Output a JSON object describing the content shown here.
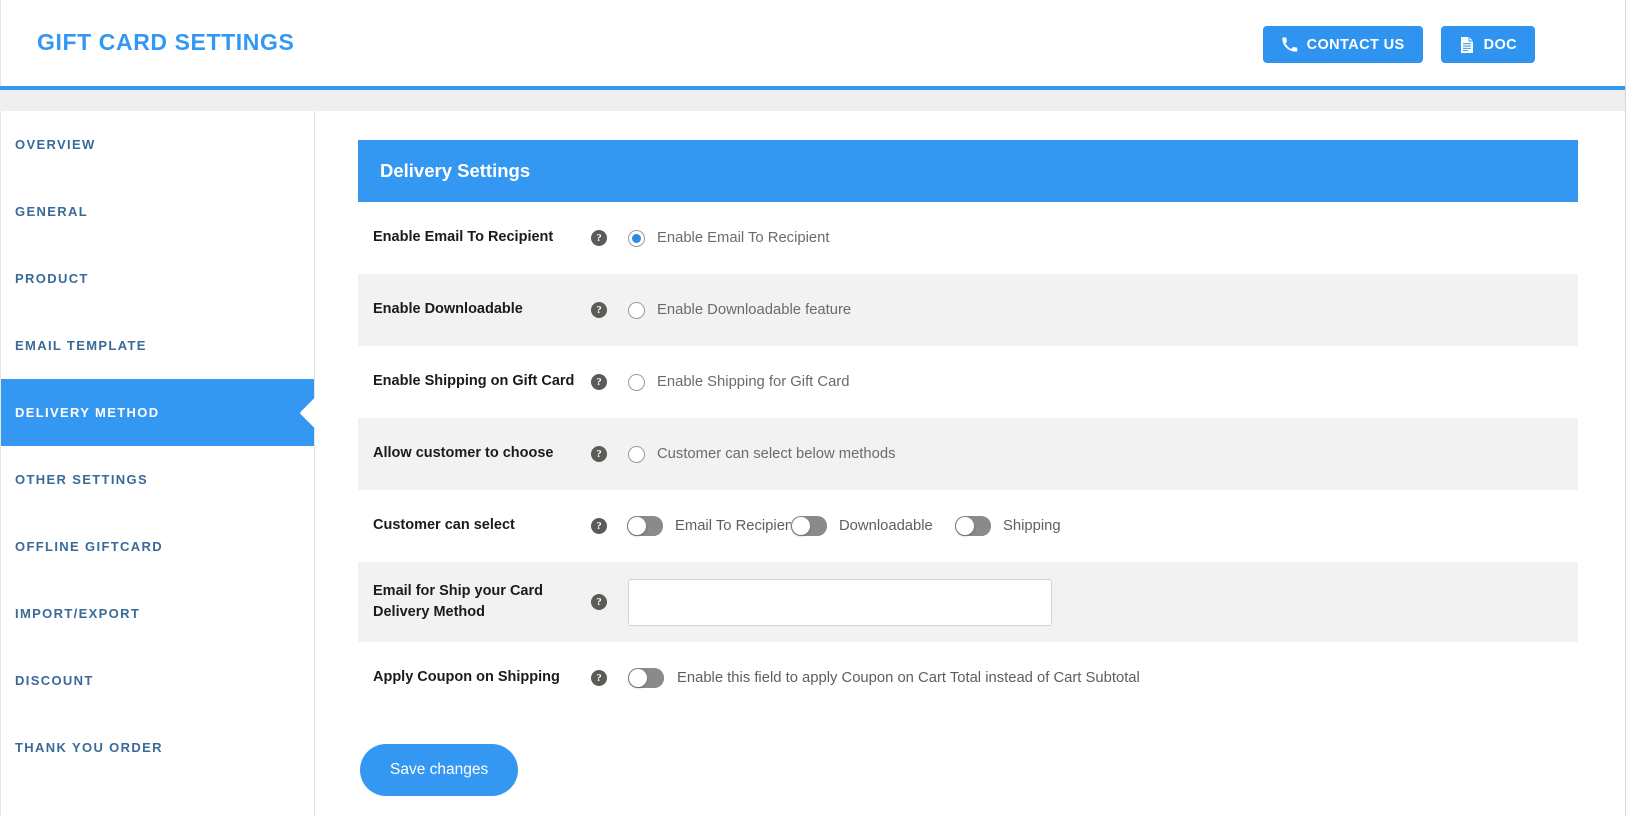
{
  "header": {
    "title": "GIFT CARD SETTINGS",
    "contact_label": "CONTACT US",
    "doc_label": "DOC",
    "accent_color": "#3498f3"
  },
  "sidebar": {
    "items": [
      {
        "label": "OVERVIEW",
        "active": false
      },
      {
        "label": "GENERAL",
        "active": false
      },
      {
        "label": "PRODUCT",
        "active": false
      },
      {
        "label": "EMAIL TEMPLATE",
        "active": false
      },
      {
        "label": "DELIVERY METHOD",
        "active": true
      },
      {
        "label": "OTHER SETTINGS",
        "active": false
      },
      {
        "label": "OFFLINE GIFTCARD",
        "active": false
      },
      {
        "label": "IMPORT/EXPORT",
        "active": false
      },
      {
        "label": "DISCOUNT",
        "active": false
      },
      {
        "label": "THANK YOU ORDER",
        "active": false
      }
    ]
  },
  "panel": {
    "title": "Delivery Settings",
    "rows": {
      "email_to_recipient": {
        "label": "Enable Email To Recipient",
        "help": "?",
        "option_text": "Enable Email To Recipient",
        "selected": true
      },
      "downloadable": {
        "label": "Enable Downloadable",
        "help": "?",
        "option_text": "Enable Downloadable feature",
        "selected": false
      },
      "shipping": {
        "label": "Enable Shipping on Gift Card",
        "help": "?",
        "option_text": "Enable Shipping for Gift Card",
        "selected": false
      },
      "allow_choose": {
        "label": "Allow customer to choose",
        "help": "?",
        "option_text": "Customer can select below methods",
        "selected": false
      },
      "customer_can_select": {
        "label": "Customer can select",
        "help": "?",
        "toggles": [
          {
            "label": "Email To Recipient",
            "on": false
          },
          {
            "label": "Downloadable",
            "on": false
          },
          {
            "label": "Shipping",
            "on": false
          }
        ]
      },
      "ship_email": {
        "label": "Email for Ship your Card Delivery Method",
        "help": "?",
        "value": "",
        "placeholder": ""
      },
      "apply_coupon": {
        "label": "Apply Coupon on Shipping",
        "help": "?",
        "toggle_text": "Enable this field to apply Coupon on Cart Total instead of Cart Subtotal",
        "on": false
      }
    },
    "save_label": "Save changes"
  }
}
